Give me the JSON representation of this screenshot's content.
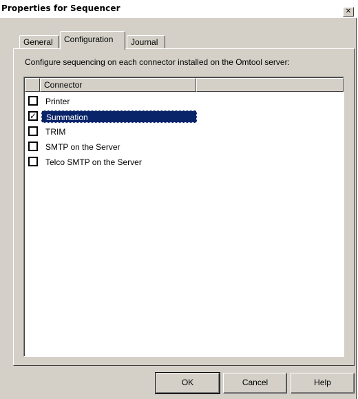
{
  "window": {
    "title": "Properties for Sequencer",
    "close_glyph": "✕"
  },
  "tabs": [
    {
      "label": "General"
    },
    {
      "label": "Configuration"
    },
    {
      "label": "Journal"
    }
  ],
  "panel": {
    "description": "Configure sequencing on each connector installed on the Omtool server:"
  },
  "list": {
    "headers": [
      "",
      "Connector",
      ""
    ],
    "rows": [
      {
        "label": "Printer",
        "checked": false,
        "selected": false
      },
      {
        "label": "Summation",
        "checked": true,
        "selected": true
      },
      {
        "label": "TRIM",
        "checked": false,
        "selected": false
      },
      {
        "label": "SMTP on the Server",
        "checked": false,
        "selected": false
      },
      {
        "label": "Telco SMTP  on the Server",
        "checked": false,
        "selected": false
      }
    ],
    "check_glyph": "✓"
  },
  "buttons": {
    "ok": "OK",
    "cancel": "Cancel",
    "help": "Help"
  },
  "colors": {
    "face": "#d4d0c8",
    "selection": "#0a246a"
  }
}
